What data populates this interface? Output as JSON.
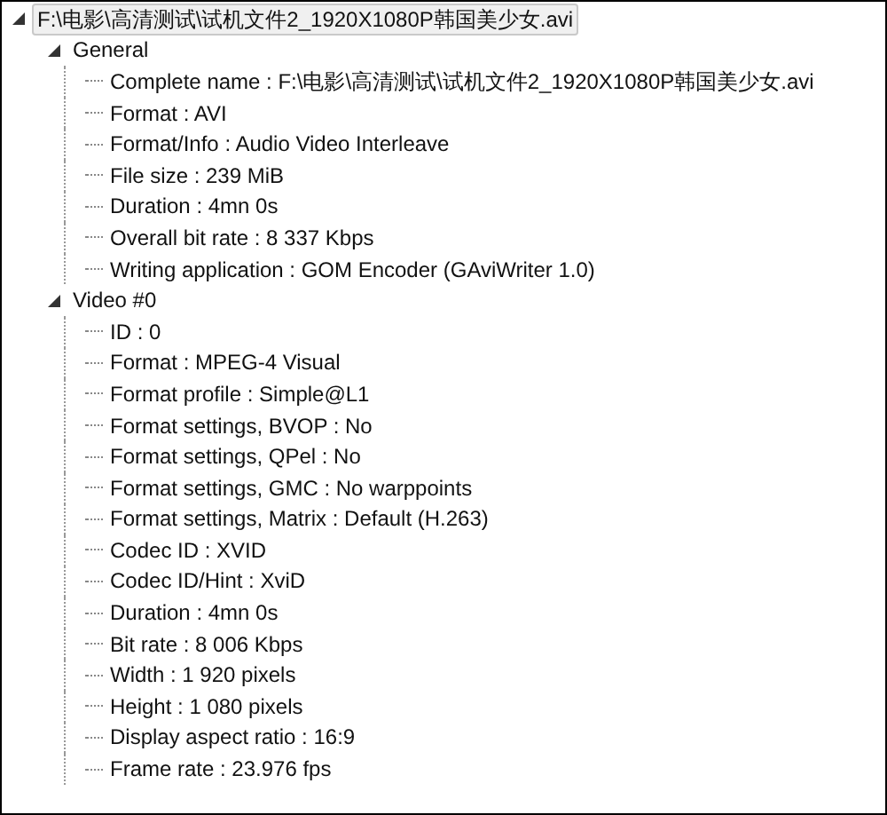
{
  "tree": [
    {
      "label": "F:\\电影\\高清测试\\试机文件2_1920X1080P韩国美少女.avi",
      "selected": true,
      "expanded": true,
      "children": [
        {
          "label": "General",
          "selected": false,
          "expanded": true,
          "children": [
            {
              "label": "Complete name : F:\\电影\\高清测试\\试机文件2_1920X1080P韩国美少女.avi",
              "selected": false
            },
            {
              "label": "Format : AVI",
              "selected": false
            },
            {
              "label": "Format/Info : Audio Video Interleave",
              "selected": false
            },
            {
              "label": "File size : 239 MiB",
              "selected": false
            },
            {
              "label": "Duration : 4mn 0s",
              "selected": false
            },
            {
              "label": "Overall bit rate : 8 337 Kbps",
              "selected": false
            },
            {
              "label": "Writing application : GOM Encoder (GAviWriter 1.0)",
              "selected": false
            }
          ]
        },
        {
          "label": "Video #0",
          "selected": false,
          "expanded": true,
          "children": [
            {
              "label": "ID : 0",
              "selected": false
            },
            {
              "label": "Format : MPEG-4 Visual",
              "selected": false
            },
            {
              "label": "Format profile : Simple@L1",
              "selected": false
            },
            {
              "label": "Format settings, BVOP : No",
              "selected": false
            },
            {
              "label": "Format settings, QPel : No",
              "selected": false
            },
            {
              "label": "Format settings, GMC : No warppoints",
              "selected": false
            },
            {
              "label": "Format settings, Matrix : Default (H.263)",
              "selected": false
            },
            {
              "label": "Codec ID : XVID",
              "selected": false
            },
            {
              "label": "Codec ID/Hint : XviD",
              "selected": false
            },
            {
              "label": "Duration : 4mn 0s",
              "selected": false
            },
            {
              "label": "Bit rate : 8 006 Kbps",
              "selected": false
            },
            {
              "label": "Width : 1 920 pixels",
              "selected": false
            },
            {
              "label": "Height : 1 080 pixels",
              "selected": false
            },
            {
              "label": "Display aspect ratio : 16:9",
              "selected": false
            },
            {
              "label": "Frame rate : 23.976 fps",
              "selected": false
            }
          ]
        }
      ]
    }
  ]
}
